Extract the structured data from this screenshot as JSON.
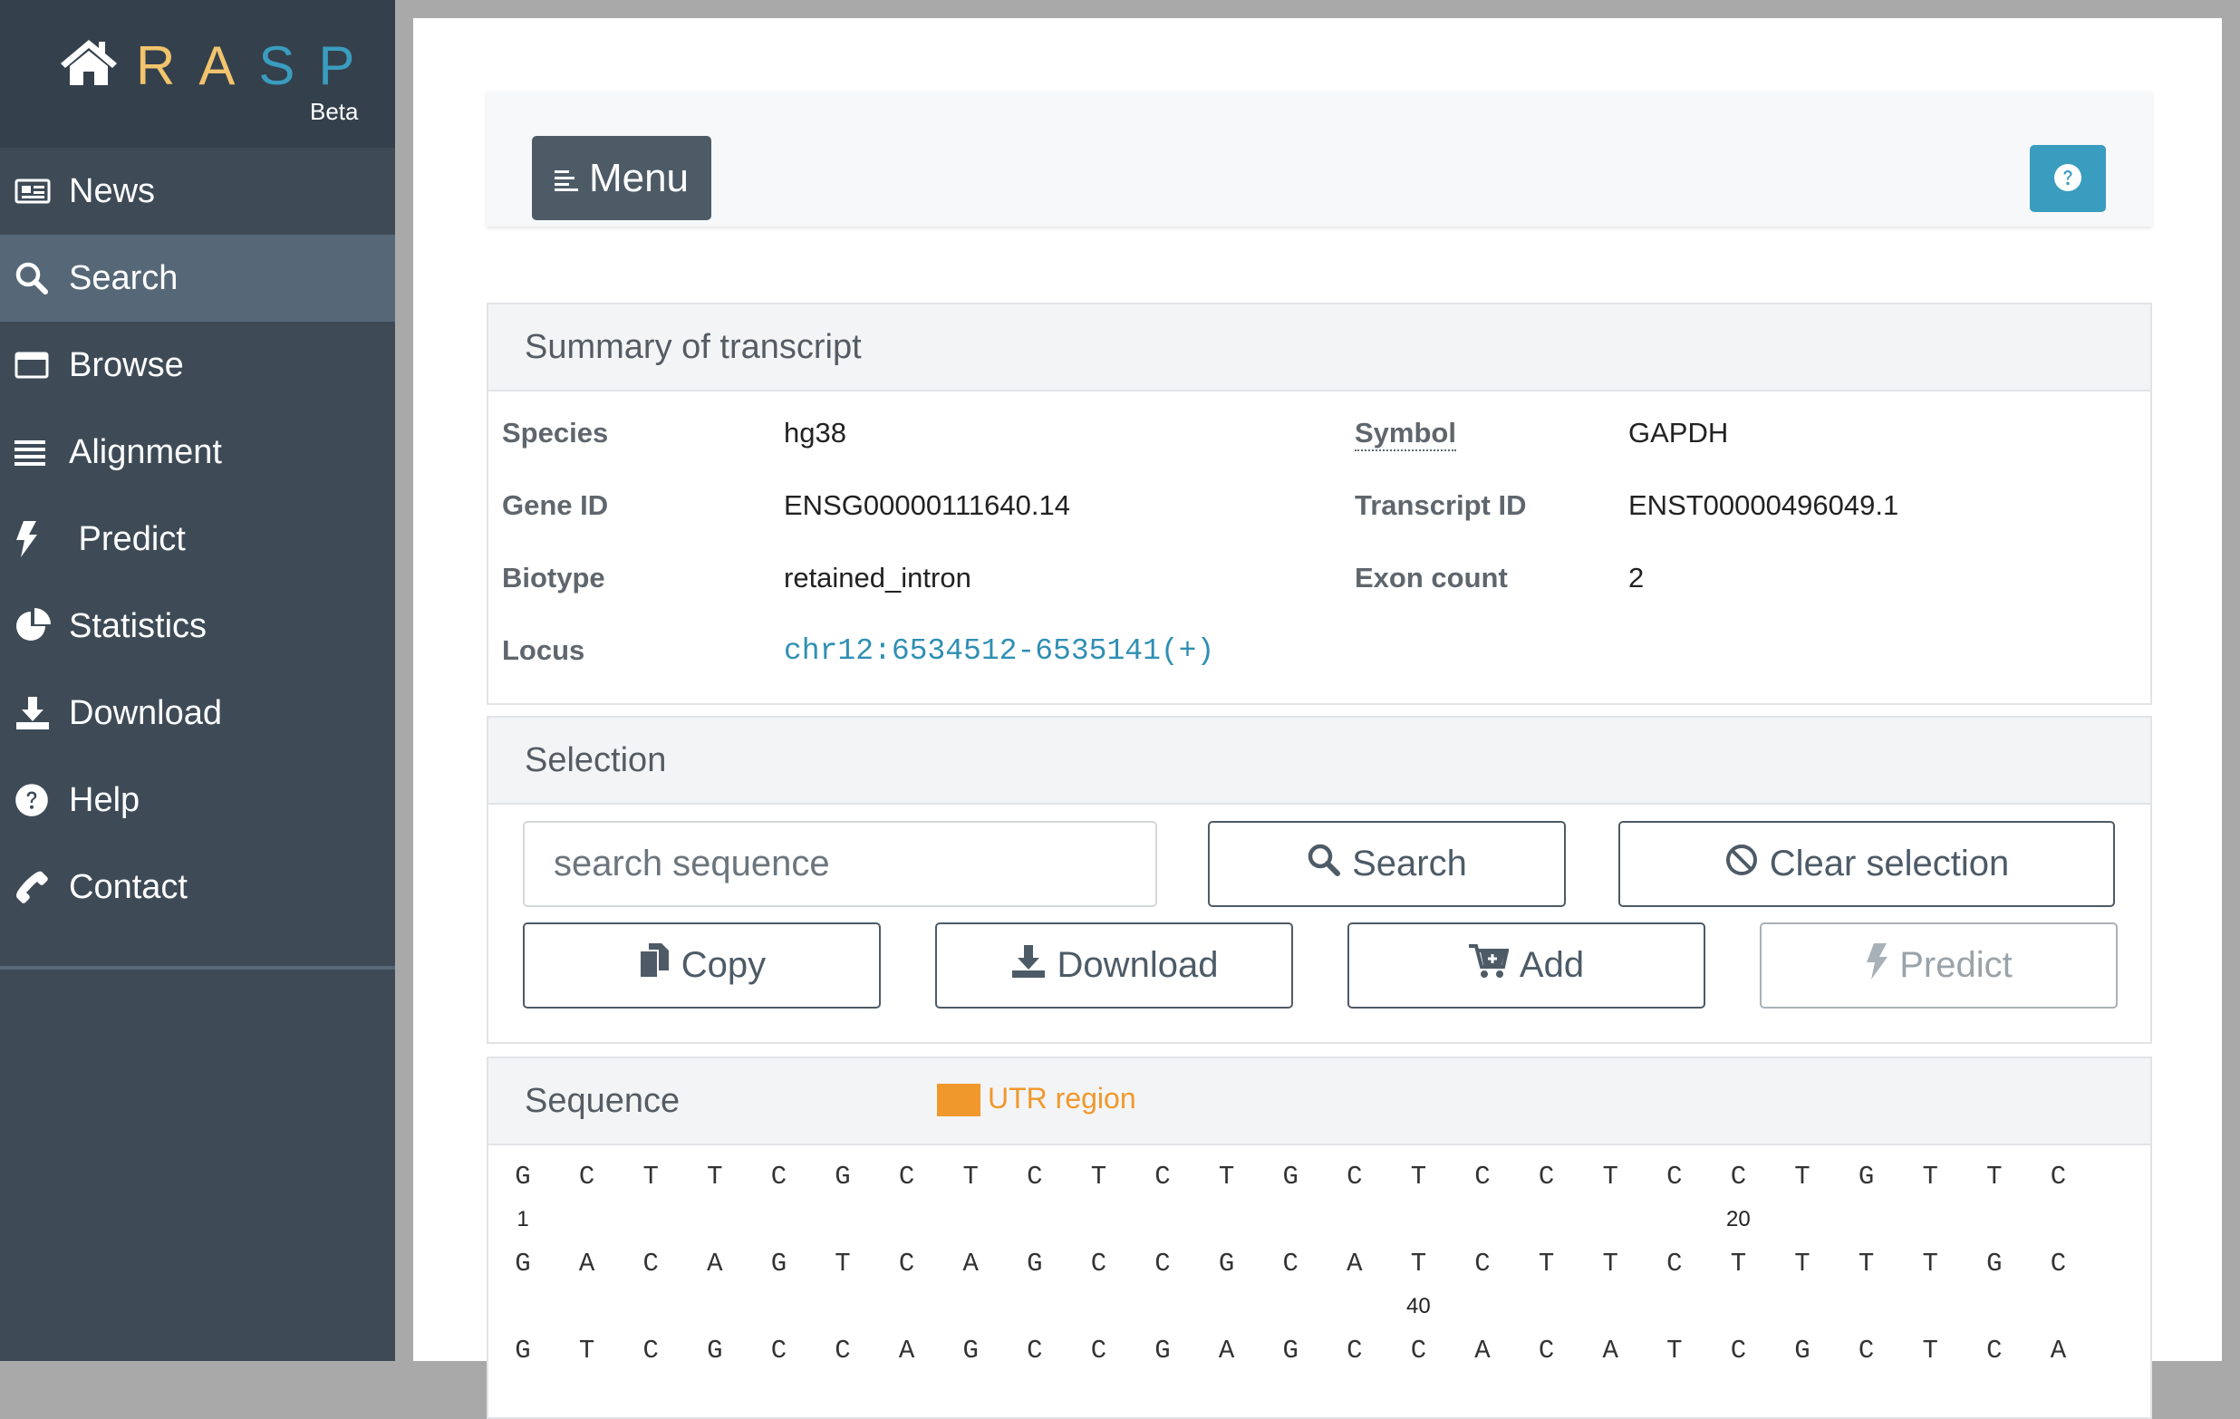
{
  "brand": {
    "letters": [
      "R",
      "A",
      "S",
      "P"
    ],
    "letter_colors": [
      "#f2c46d",
      "#f2c46d",
      "#3a9cbf",
      "#3a9cbf"
    ],
    "beta": "Beta"
  },
  "sidebar": {
    "items": [
      {
        "label": "News",
        "icon": "newspaper-icon",
        "active": false
      },
      {
        "label": "Search",
        "icon": "search-icon",
        "active": true
      },
      {
        "label": "Browse",
        "icon": "window-icon",
        "active": false
      },
      {
        "label": "Alignment",
        "icon": "bars-icon",
        "active": false
      },
      {
        "label": " Predict",
        "icon": "bolt-icon",
        "active": false
      },
      {
        "label": "Statistics",
        "icon": "pie-chart-icon",
        "active": false
      },
      {
        "label": "Download",
        "icon": "download-icon",
        "active": false
      },
      {
        "label": "Help",
        "icon": "question-circle-icon",
        "active": false
      },
      {
        "label": "Contact",
        "icon": "phone-icon",
        "active": false
      }
    ]
  },
  "toolbar": {
    "menu_label": "Menu",
    "help_icon": "question-circle-icon"
  },
  "summary": {
    "title": "Summary of transcript",
    "species_label": "Species",
    "species": "hg38",
    "symbol_label": "Symbol",
    "symbol": "GAPDH",
    "gene_id_label": "Gene ID",
    "gene_id": "ENSG00000111640.14",
    "transcript_id_label": "Transcript ID",
    "transcript_id": "ENST00000496049.1",
    "biotype_label": "Biotype",
    "biotype": "retained_intron",
    "exon_count_label": "Exon count",
    "exon_count": "2",
    "locus_label": "Locus",
    "locus": "chr12:6534512-6535141(+)"
  },
  "selection": {
    "title": "Selection",
    "search_placeholder": "search sequence",
    "search_label": "Search",
    "clear_label": "Clear selection",
    "copy_label": "Copy",
    "download_label": "Download",
    "add_label": "Add",
    "predict_label": "Predict"
  },
  "sequence": {
    "title": "Sequence",
    "legend_label": "UTR region",
    "legend_color": "#f0982c",
    "rows": [
      {
        "bases": [
          "G",
          "C",
          "T",
          "T",
          "C",
          "G",
          "C",
          "T",
          "C",
          "T",
          "C",
          "T",
          "G",
          "C",
          "T",
          "C",
          "C",
          "T",
          "C",
          "C",
          "T",
          "G",
          "T",
          "T",
          "C"
        ],
        "markers": [
          {
            "index": 0,
            "label": "1"
          },
          {
            "index": 19,
            "label": "20"
          }
        ]
      },
      {
        "bases": [
          "G",
          "A",
          "C",
          "A",
          "G",
          "T",
          "C",
          "A",
          "G",
          "C",
          "C",
          "G",
          "C",
          "A",
          "T",
          "C",
          "T",
          "T",
          "C",
          "T",
          "T",
          "T",
          "T",
          "G",
          "C"
        ],
        "markers": [
          {
            "index": 14,
            "label": "40"
          }
        ]
      },
      {
        "bases": [
          "G",
          "T",
          "C",
          "G",
          "C",
          "C",
          "A",
          "G",
          "C",
          "C",
          "G",
          "A",
          "G",
          "C",
          "C",
          "A",
          "C",
          "A",
          "T",
          "C",
          "G",
          "C",
          "T",
          "C",
          "A"
        ],
        "markers": []
      }
    ]
  }
}
